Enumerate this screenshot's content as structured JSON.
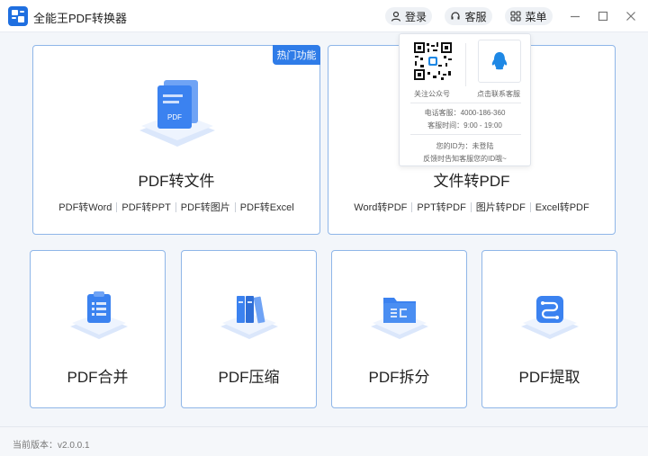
{
  "app": {
    "title": "全能王PDF转换器"
  },
  "header": {
    "login_label": "登录",
    "service_label": "客服",
    "menu_label": "菜单"
  },
  "cards": {
    "pdf_to_file": {
      "tag": "热门功能",
      "title": "PDF转文件",
      "links": [
        "PDF转Word",
        "PDF转PPT",
        "PDF转图片",
        "PDF转Excel"
      ]
    },
    "file_to_pdf": {
      "title": "文件转PDF",
      "links": [
        "Word转PDF",
        "PPT转PDF",
        "图片转PDF",
        "Excel转PDF"
      ]
    },
    "merge": {
      "title": "PDF合并"
    },
    "compress": {
      "title": "PDF压缩"
    },
    "split": {
      "title": "PDF拆分"
    },
    "extract": {
      "title": "PDF提取"
    }
  },
  "popup": {
    "qr_caption": "关注公众号",
    "qq_caption": "点击联系客服",
    "phone": "电话客服：4000-186-360",
    "hours": "客服时间：9:00 - 19:00",
    "id_line": "您的ID为：未登陆",
    "feedback": "反馈时告知客服您的ID哦~"
  },
  "footer": {
    "version": "当前版本：v2.0.0.1"
  },
  "colors": {
    "accent": "#2f7ce8",
    "card_border": "#8fb6e8",
    "icon_blue": "#3b82f0",
    "qq_blue": "#1e88e5"
  },
  "icons": [
    "app-logo-icon",
    "user-icon",
    "headset-icon",
    "menu-icon",
    "minimize-icon",
    "maximize-icon",
    "close-icon",
    "qq-icon"
  ]
}
